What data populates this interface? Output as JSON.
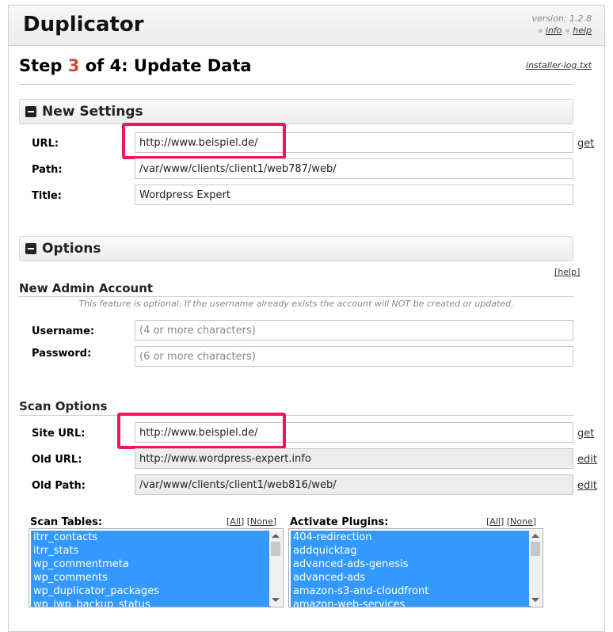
{
  "header": {
    "app_title": "Duplicator",
    "version": "version: 1.2.8",
    "info_label": "info",
    "help_label": "help"
  },
  "page": {
    "step_prefix": "Step",
    "step_current": "3",
    "step_suffix": "of 4: Update Data",
    "log_link": "installer-log.txt"
  },
  "new_settings": {
    "title": "New Settings",
    "url_label": "URL:",
    "url_value": "http://www.beispiel.de/",
    "url_get": "get",
    "path_label": "Path:",
    "path_value": "/var/www/clients/client1/web787/web/",
    "title_label": "Title:",
    "title_value": "Wordpress Expert"
  },
  "options": {
    "title": "Options",
    "help_link": "[help]",
    "admin": {
      "heading": "New Admin Account",
      "note": "This feature is optional. If the username already exists the account will NOT be created or updated.",
      "username_label": "Username:",
      "username_placeholder": "(4 or more characters)",
      "password_label": "Password:",
      "password_placeholder": "(6 or more characters)"
    },
    "scan": {
      "heading": "Scan Options",
      "site_url_label": "Site URL:",
      "site_url_value": "http://www.beispiel.de/",
      "site_url_get": "get",
      "old_url_label": "Old URL:",
      "old_url_value": "http://www.wordpress-expert.info",
      "old_url_edit": "edit",
      "old_path_label": "Old Path:",
      "old_path_value": "/var/www/clients/client1/web816/web/",
      "old_path_edit": "edit"
    },
    "tables": {
      "label": "Scan Tables:",
      "all": "All",
      "none": "None",
      "items": [
        "itrr_contacts",
        "itrr_stats",
        "wp_commentmeta",
        "wp_comments",
        "wp_duplicator_packages",
        "wp_iwp_backup_status"
      ]
    },
    "plugins": {
      "label": "Activate Plugins:",
      "all": "All",
      "none": "None",
      "items": [
        "404-redirection",
        "addquicktag",
        "advanced-ads-genesis",
        "advanced-ads",
        "amazon-s3-and-cloudfront",
        "amazon-web-services"
      ]
    }
  },
  "colors": {
    "highlight_border": "#f0145a",
    "step_number": "#cc4a2e",
    "list_selection": "#3399ff"
  }
}
